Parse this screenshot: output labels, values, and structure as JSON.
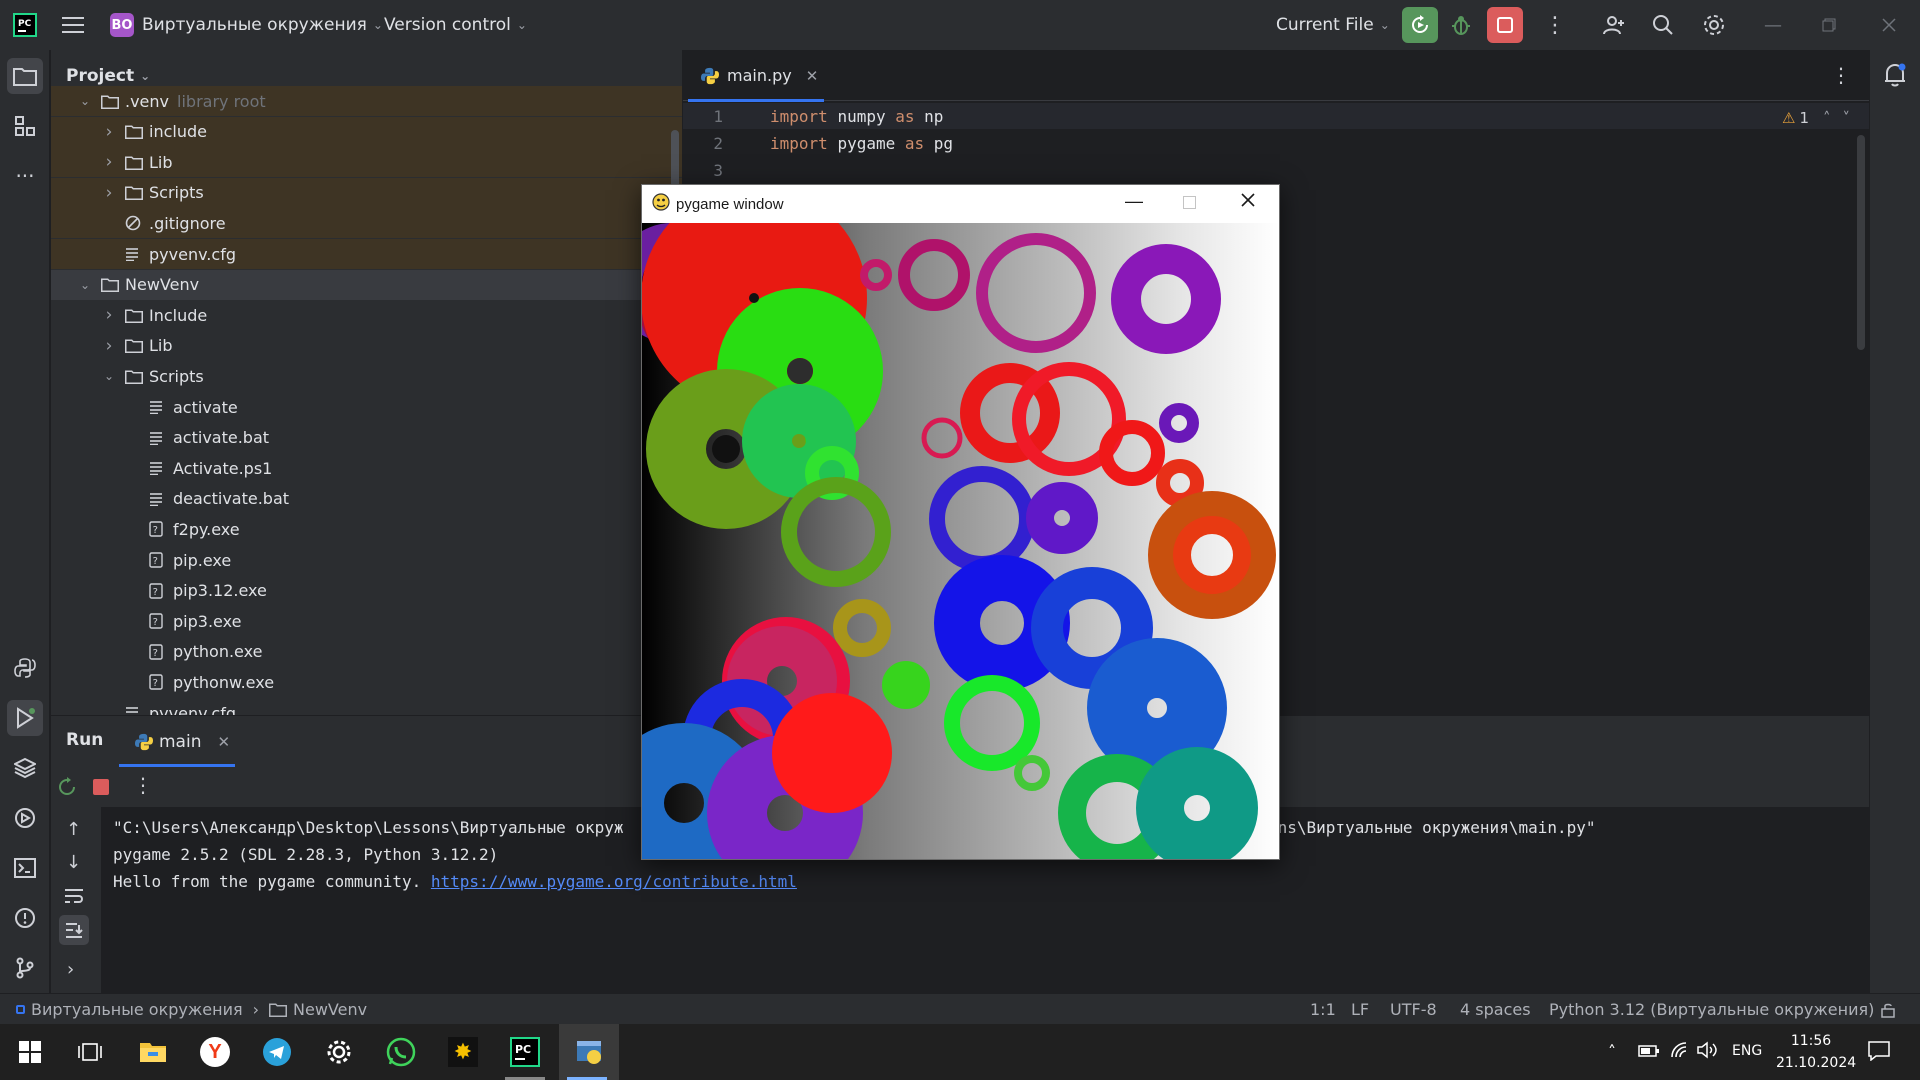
{
  "titlebar": {
    "project_badge": "ВО",
    "project_name": "Виртуальные окружения",
    "vcs_label": "Version control",
    "run_config": "Current File"
  },
  "project_panel": {
    "title": "Project",
    "rows": [
      {
        "label": ".venv",
        "suffix": "library root",
        "kind": "folder",
        "expanded": true,
        "indent": 0
      },
      {
        "label": "include",
        "kind": "folder",
        "expanded": false,
        "indent": 1
      },
      {
        "label": "Lib",
        "kind": "folder",
        "expanded": false,
        "indent": 1
      },
      {
        "label": "Scripts",
        "kind": "folder",
        "expanded": false,
        "indent": 1
      },
      {
        "label": ".gitignore",
        "kind": "ignore",
        "indent": 1
      },
      {
        "label": "pyvenv.cfg",
        "kind": "text",
        "indent": 1
      },
      {
        "label": "NewVenv",
        "kind": "folder",
        "expanded": true,
        "indent": 0
      },
      {
        "label": "Include",
        "kind": "folder",
        "expanded": false,
        "indent": 1
      },
      {
        "label": "Lib",
        "kind": "folder",
        "expanded": false,
        "indent": 1
      },
      {
        "label": "Scripts",
        "kind": "folder",
        "expanded": true,
        "indent": 1
      },
      {
        "label": "activate",
        "kind": "text",
        "indent": 2
      },
      {
        "label": "activate.bat",
        "kind": "text",
        "indent": 2
      },
      {
        "label": "Activate.ps1",
        "kind": "text",
        "indent": 2
      },
      {
        "label": "deactivate.bat",
        "kind": "text",
        "indent": 2
      },
      {
        "label": "f2py.exe",
        "kind": "unknown",
        "indent": 2
      },
      {
        "label": "pip.exe",
        "kind": "unknown",
        "indent": 2
      },
      {
        "label": "pip3.12.exe",
        "kind": "unknown",
        "indent": 2
      },
      {
        "label": "pip3.exe",
        "kind": "unknown",
        "indent": 2
      },
      {
        "label": "python.exe",
        "kind": "unknown",
        "indent": 2
      },
      {
        "label": "pythonw.exe",
        "kind": "unknown",
        "indent": 2
      },
      {
        "label": "pyvenv.cfg",
        "kind": "text",
        "indent": 1
      }
    ]
  },
  "editor": {
    "tab_label": "main.py",
    "warning_count": "1",
    "lines": [
      {
        "num": "1",
        "kw1": "import",
        "mod": "numpy",
        "kw2": "as",
        "alias": "np"
      },
      {
        "num": "2",
        "kw1": "import",
        "mod": "pygame",
        "kw2": "as",
        "alias": "pg"
      },
      {
        "num": "3",
        "kw1": "",
        "mod": "",
        "kw2": "",
        "alias": ""
      }
    ]
  },
  "run_panel": {
    "title": "Run",
    "tab_label": "main",
    "output": {
      "line1_start": "\"C:\\Users\\Александр\\Desktop\\Lessons\\Виртуальные окруж",
      "line1_end": "ons\\Виртуальные окружения\\main.py\"",
      "line2": "pygame 2.5.2 (SDL 2.28.3, Python 3.12.2)",
      "line3_text": "Hello from the pygame community. ",
      "line3_link": "https://www.pygame.org/contribute.html"
    }
  },
  "statusbar": {
    "crumb_project": "Виртуальные окружения",
    "crumb_folder": "NewVenv",
    "position": "1:1",
    "line_sep": "LF",
    "encoding": "UTF-8",
    "indent": "4 spaces",
    "interpreter": "Python 3.12 (Виртуальные окружения)"
  },
  "pygame_window": {
    "title": "pygame window"
  },
  "taskbar": {
    "lang": "ENG",
    "time": "11:56",
    "date": "21.10.2024"
  },
  "colors": {
    "accent": "#3574f0",
    "run_green": "#57965c",
    "stop_red": "#db5c5c",
    "keyword": "#cf8e6d",
    "link": "#548af7"
  }
}
